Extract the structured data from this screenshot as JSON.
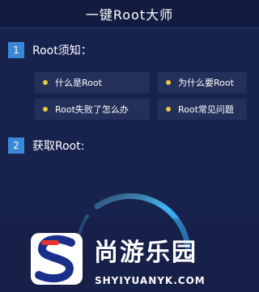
{
  "header": {
    "title": "一键Root大师"
  },
  "sections": [
    {
      "number": "1",
      "label": "Root须知："
    },
    {
      "number": "2",
      "label": "获取Root:"
    }
  ],
  "faq": [
    "什么是Root",
    "为什么要Root",
    "Root失败了怎么办",
    "Root常见问题"
  ],
  "watermark": {
    "text": "尚游乐园",
    "url": "SHYIYUANYK.COM"
  },
  "colors": {
    "background": "#18234d",
    "accent": "#3a86d7",
    "bullet": "#e4c93a",
    "ring": "#3db6f2",
    "logo_red": "#e8332e"
  }
}
